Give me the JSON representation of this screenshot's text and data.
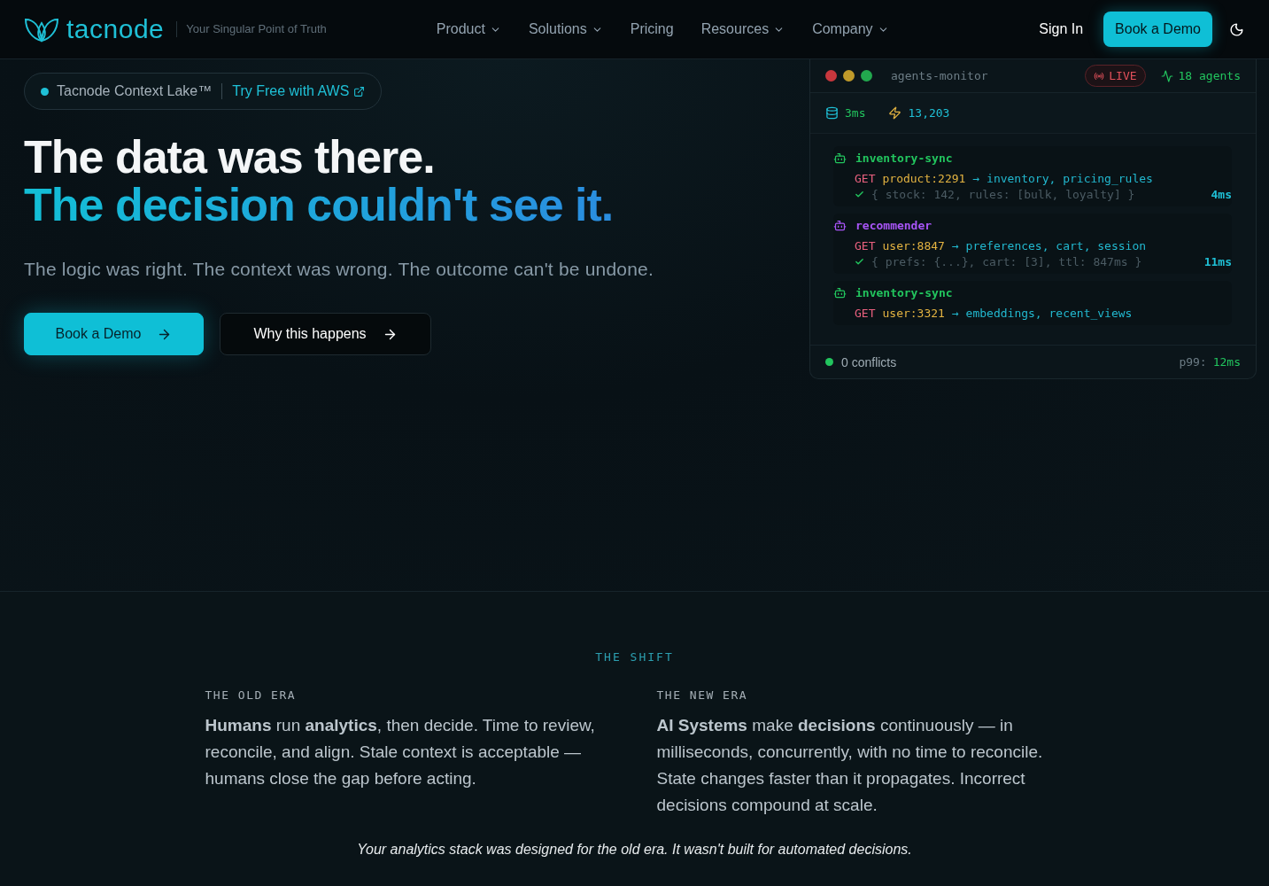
{
  "nav": {
    "logo": "tacnode",
    "tagline": "Your Singular Point of Truth",
    "links": [
      {
        "label": "Product",
        "has_menu": true
      },
      {
        "label": "Solutions",
        "has_menu": true
      },
      {
        "label": "Pricing",
        "has_menu": false
      },
      {
        "label": "Resources",
        "has_menu": true
      },
      {
        "label": "Company",
        "has_menu": true
      }
    ],
    "sign_in": "Sign In",
    "cta": "Book a Demo"
  },
  "hero": {
    "badge": {
      "label": "Tacnode Context Lake™",
      "link": "Try Free with AWS"
    },
    "headline": [
      "The data was there.",
      "The decision couldn't see it."
    ],
    "subtitle": "The logic was right. The context was wrong. The outcome can't be undone.",
    "buttons": [
      {
        "label": "Book a Demo",
        "kind": "primary"
      },
      {
        "label": "Why this happens",
        "kind": "secondary"
      }
    ]
  },
  "monitor": {
    "title": "agents-monitor",
    "live": "LIVE",
    "agents": "18 agents",
    "latency": "3ms",
    "throughput": "13,203",
    "entries": [
      {
        "agent": "inventory-sync",
        "color": "#22c55e",
        "method": "GET",
        "key": "product:2291",
        "targets": "→ inventory, pricing_rules",
        "result": "{ stock: 142, rules: [bulk, loyalty] }",
        "time": "4ms"
      },
      {
        "agent": "recommender",
        "color": "#a855f7",
        "method": "GET",
        "key": "user:8847",
        "targets": "→ preferences, cart, session",
        "result": "{ prefs: {...}, cart: [3], ttl: 847ms }",
        "time": "11ms"
      },
      {
        "agent": "inventory-sync",
        "color": "#22c55e",
        "method": "GET",
        "key": "user:3321",
        "targets": "→ embeddings, recent_views"
      }
    ],
    "conflicts": "0 conflicts",
    "p99_label": "p99:",
    "p99_value": "12ms"
  },
  "shift": {
    "eyebrow": "THE SHIFT",
    "columns": [
      {
        "label": "THE OLD ERA",
        "text": "**Humans** run **analytics**, then decide. Time to review, reconcile, and align. Stale context is acceptable — humans close the gap before acting."
      },
      {
        "label": "THE NEW ERA",
        "text": "**AI Systems** make **decisions** continuously — in milliseconds, concurrently, with no time to reconcile. State changes faster than it propagates. Incorrect decisions compound at scale."
      }
    ],
    "footnote": "Your analytics stack was designed for the old era. It wasn't built for automated decisions."
  }
}
